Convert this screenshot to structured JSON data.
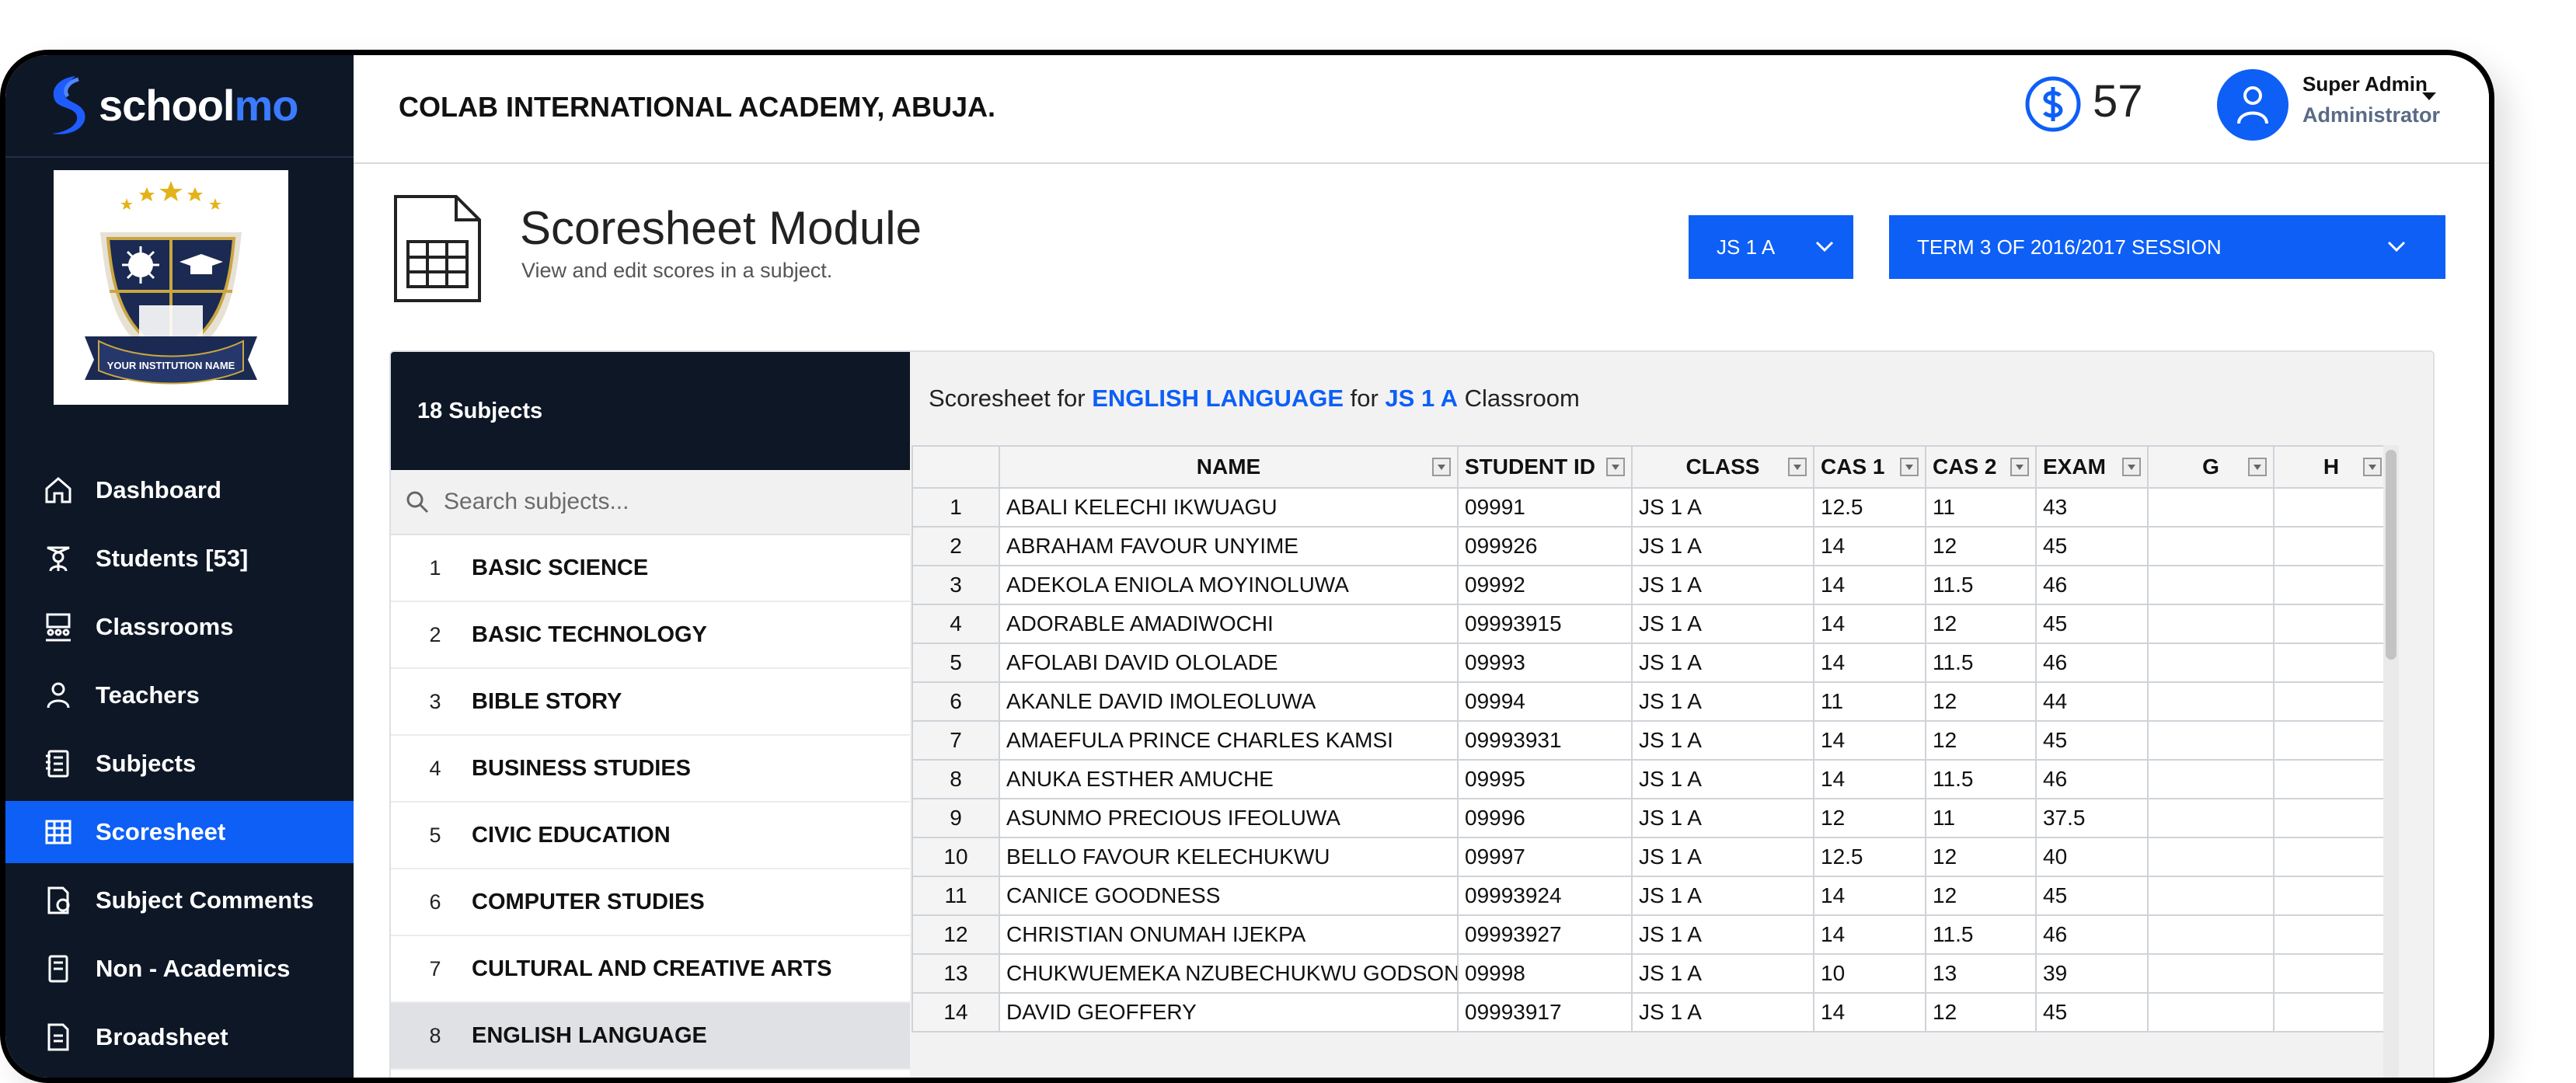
{
  "brand": {
    "logo_text_main": "school",
    "logo_text_accent": "mo",
    "crest_ribbon": "YOUR INSTITUTION NAME"
  },
  "header": {
    "school_name": "COLAB INTERNATIONAL ACADEMY, ABUJA.",
    "credits": "57",
    "user_name": "Super Admin",
    "user_role": "Administrator"
  },
  "sidebar": {
    "items": [
      {
        "label": "Dashboard",
        "icon": "home-icon"
      },
      {
        "label": "Students [53]",
        "icon": "student-icon"
      },
      {
        "label": "Classrooms",
        "icon": "classroom-icon"
      },
      {
        "label": "Teachers",
        "icon": "teacher-icon"
      },
      {
        "label": "Subjects",
        "icon": "subjects-icon"
      },
      {
        "label": "Scoresheet",
        "icon": "scoresheet-icon",
        "active": true
      },
      {
        "label": "Subject Comments",
        "icon": "comments-icon"
      },
      {
        "label": "Non - Academics",
        "icon": "non-academics-icon"
      },
      {
        "label": "Broadsheet",
        "icon": "broadsheet-icon"
      }
    ]
  },
  "module": {
    "title": "Scoresheet Module",
    "subtitle": "View and edit scores in a subject.",
    "class_select": "JS 1 A",
    "term_select": "TERM 3 OF 2016/2017 SESSION"
  },
  "subjects": {
    "heading": "18 Subjects",
    "search_placeholder": "Search subjects...",
    "items": [
      {
        "num": "1",
        "name": "BASIC SCIENCE"
      },
      {
        "num": "2",
        "name": "BASIC TECHNOLOGY"
      },
      {
        "num": "3",
        "name": "BIBLE STORY"
      },
      {
        "num": "4",
        "name": "BUSINESS STUDIES"
      },
      {
        "num": "5",
        "name": "CIVIC EDUCATION"
      },
      {
        "num": "6",
        "name": "COMPUTER STUDIES"
      },
      {
        "num": "7",
        "name": "CULTURAL AND CREATIVE ARTS"
      },
      {
        "num": "8",
        "name": "ENGLISH LANGUAGE",
        "active": true
      }
    ]
  },
  "sheet": {
    "caption_pre": "Scoresheet for ",
    "caption_subject": "ENGLISH LANGUAGE",
    "caption_mid": " for ",
    "caption_class": "JS 1 A",
    "caption_post": " Classroom",
    "columns": [
      "NAME",
      "STUDENT ID",
      "CLASS",
      "CAS 1",
      "CAS 2",
      "EXAM",
      "G",
      "H"
    ],
    "rows": [
      [
        "1",
        "ABALI KELECHI IKWUAGU",
        "09991",
        "JS 1 A",
        "12.5",
        "11",
        "43"
      ],
      [
        "2",
        "ABRAHAM FAVOUR UNYIME",
        "099926",
        "JS 1 A",
        "14",
        "12",
        "45"
      ],
      [
        "3",
        "ADEKOLA ENIOLA MOYINOLUWA",
        "09992",
        "JS 1 A",
        "14",
        "11.5",
        "46"
      ],
      [
        "4",
        "ADORABLE AMADIWOCHI",
        "09993915",
        "JS 1 A",
        "14",
        "12",
        "45"
      ],
      [
        "5",
        "AFOLABI DAVID OLOLADE",
        "09993",
        "JS 1 A",
        "14",
        "11.5",
        "46"
      ],
      [
        "6",
        "AKANLE DAVID IMOLEOLUWA",
        "09994",
        "JS 1 A",
        "11",
        "12",
        "44"
      ],
      [
        "7",
        "AMAEFULA PRINCE CHARLES KAMSI",
        "09993931",
        "JS 1 A",
        "14",
        "12",
        "45"
      ],
      [
        "8",
        "ANUKA ESTHER AMUCHE",
        "09995",
        "JS 1 A",
        "14",
        "11.5",
        "46"
      ],
      [
        "9",
        "ASUNMO PRECIOUS IFEOLUWA",
        "09996",
        "JS 1 A",
        "12",
        "11",
        "37.5"
      ],
      [
        "10",
        "BELLO FAVOUR KELECHUKWU",
        "09997",
        "JS 1 A",
        "12.5",
        "12",
        "40"
      ],
      [
        "11",
        "CANICE GOODNESS",
        "09993924",
        "JS 1 A",
        "14",
        "12",
        "45"
      ],
      [
        "12",
        "CHRISTIAN ONUMAH IJEKPA",
        "09993927",
        "JS 1 A",
        "14",
        "11.5",
        "46"
      ],
      [
        "13",
        "CHUKWUEMEKA NZUBECHUKWU GODSON",
        "09998",
        "JS 1 A",
        "10",
        "13",
        "39"
      ],
      [
        "14",
        "DAVID GEOFFERY",
        "09993917",
        "JS 1 A",
        "14",
        "12",
        "45"
      ]
    ]
  },
  "colors": {
    "sidebar_bg": "#0e1726",
    "accent": "#0d5ff6"
  }
}
